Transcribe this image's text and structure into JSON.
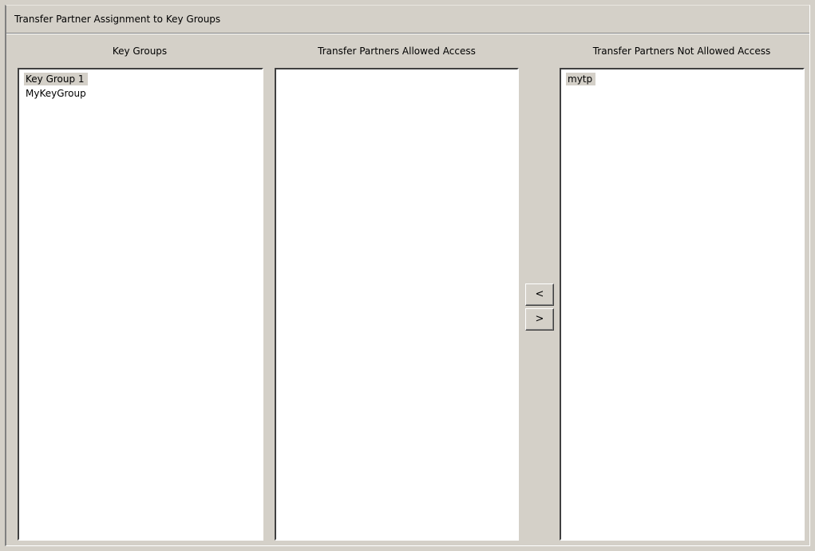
{
  "panel": {
    "title": "Transfer Partner Assignment to Key Groups"
  },
  "columns": {
    "key_groups": {
      "header": "Key Groups",
      "items": [
        {
          "label": "Key Group 1",
          "selected": true
        },
        {
          "label": "MyKeyGroup",
          "selected": false
        }
      ]
    },
    "allowed": {
      "header": "Transfer Partners Allowed Access",
      "items": []
    },
    "not_allowed": {
      "header": "Transfer Partners Not Allowed Access",
      "items": [
        {
          "label": "mytp",
          "selected": true
        }
      ]
    }
  },
  "buttons": {
    "move_left_label": "<",
    "move_right_label": ">"
  },
  "colors": {
    "background": "#d4d0c8",
    "list_background": "#ffffff",
    "selection": "#d4d0c8"
  }
}
